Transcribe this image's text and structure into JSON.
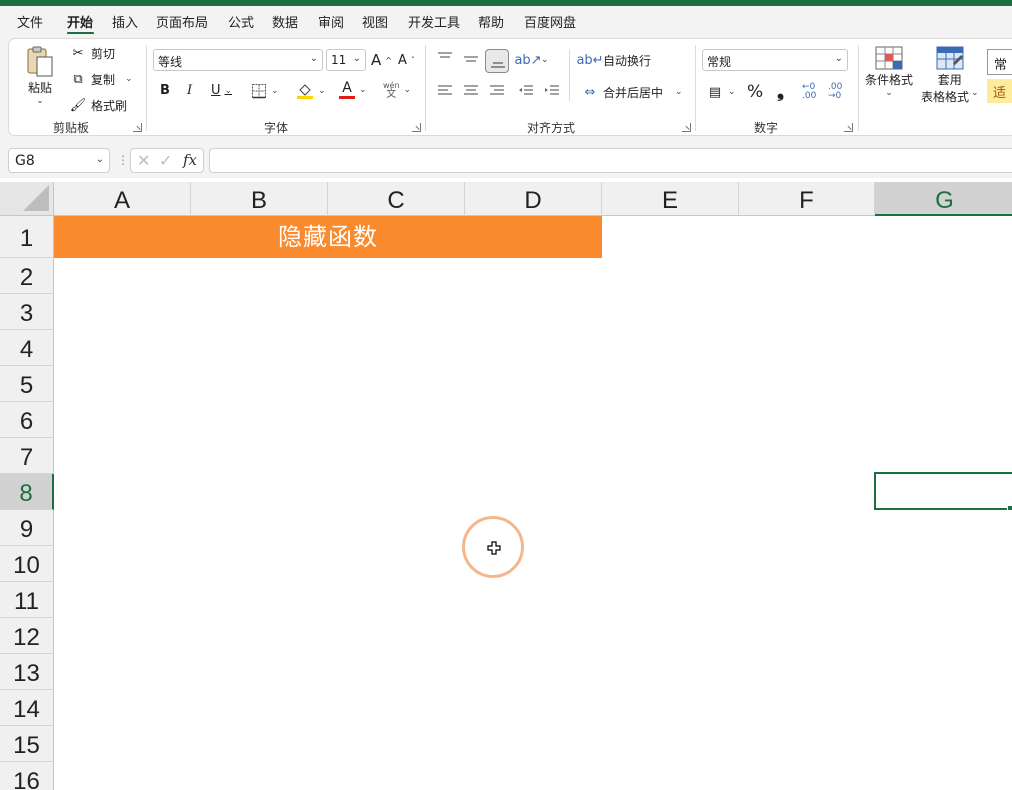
{
  "menu": {
    "items": [
      "文件",
      "开始",
      "插入",
      "页面布局",
      "公式",
      "数据",
      "审阅",
      "视图",
      "开发工具",
      "帮助",
      "百度网盘"
    ],
    "active": "开始"
  },
  "ribbon": {
    "clipboard": {
      "paste_label": "粘贴",
      "cut_label": "剪切",
      "copy_label": "复制",
      "format_painter_label": "格式刷",
      "group_label": "剪贴板"
    },
    "font": {
      "font_name": "等线",
      "font_size": "11",
      "bold": "B",
      "italic": "I",
      "underline": "U",
      "font_color_glyph": "A",
      "phonetic_top": "wén",
      "phonetic_bottom": "文",
      "grow_glyph": "A",
      "shrink_glyph": "A",
      "group_label": "字体"
    },
    "alignment": {
      "wrap_text_label": "自动换行",
      "merge_center_label": "合并后居中",
      "group_label": "对齐方式"
    },
    "number": {
      "format_value": "常规",
      "percent": "%",
      "comma": "❟",
      "group_label": "数字"
    },
    "styles": {
      "conditional_format_label": "条件格式",
      "table_format_line1": "套用",
      "table_format_line2": "表格格式",
      "style_normal": "常",
      "style_good": "适"
    }
  },
  "formula_bar": {
    "name_box": "G8",
    "fx_label": "fx",
    "formula": ""
  },
  "sheet": {
    "columns": [
      "A",
      "B",
      "C",
      "D",
      "E",
      "F",
      "G"
    ],
    "selected_column": "G",
    "rows": [
      "1",
      "2",
      "3",
      "4",
      "5",
      "6",
      "7",
      "8",
      "9",
      "10",
      "11",
      "12",
      "13",
      "14",
      "15",
      "16"
    ],
    "selected_row": "8",
    "title_cell_text": "隐藏函数",
    "title_fill_color": "#f98a2e",
    "accent_color": "#1e6e43"
  }
}
